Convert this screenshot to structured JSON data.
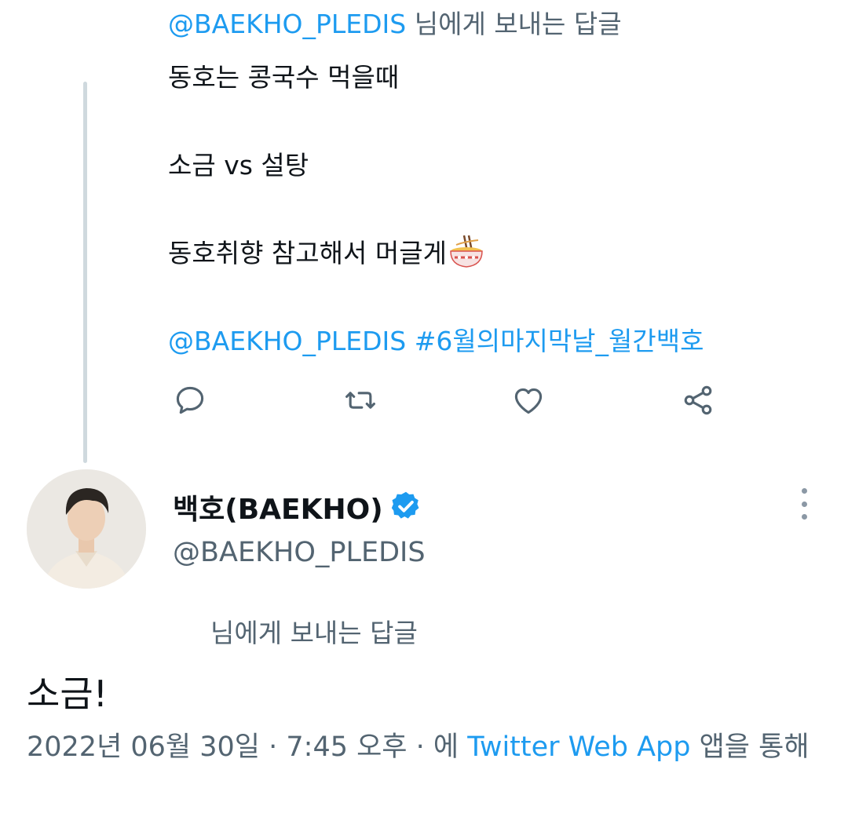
{
  "parent_tweet": {
    "replying_to_handle": "@BAEKHO_PLEDIS",
    "replying_to_suffix": " 님에게 보내는 답글",
    "lines": [
      "동호는 콩국수 먹을때",
      "소금 vs 설탕",
      "동호취향 참고해서 머글게"
    ],
    "emoji": "steaming-bowl",
    "footer_mention": "@BAEKHO_PLEDIS",
    "footer_hashtag": "#6월의마지막날_월간백호",
    "actions": [
      "reply-icon",
      "retweet-icon",
      "like-icon",
      "share-icon"
    ]
  },
  "reply_tweet": {
    "author_name": "백호(BAEKHO)",
    "verified": true,
    "handle": "@BAEKHO_PLEDIS",
    "replying_to_suffix": "님에게 보내는 답글",
    "text": "소금!",
    "date": "2022년 06월 30일",
    "separator": " · ",
    "time": "7:45 오후",
    "via_prefix": "에 ",
    "source_app": "Twitter Web App",
    "via_suffix": " 앱을 통해"
  },
  "colors": {
    "link": "#1d9bf0",
    "text": "#0f1419",
    "secondary": "#536471",
    "thread_line": "#cfd9de"
  }
}
